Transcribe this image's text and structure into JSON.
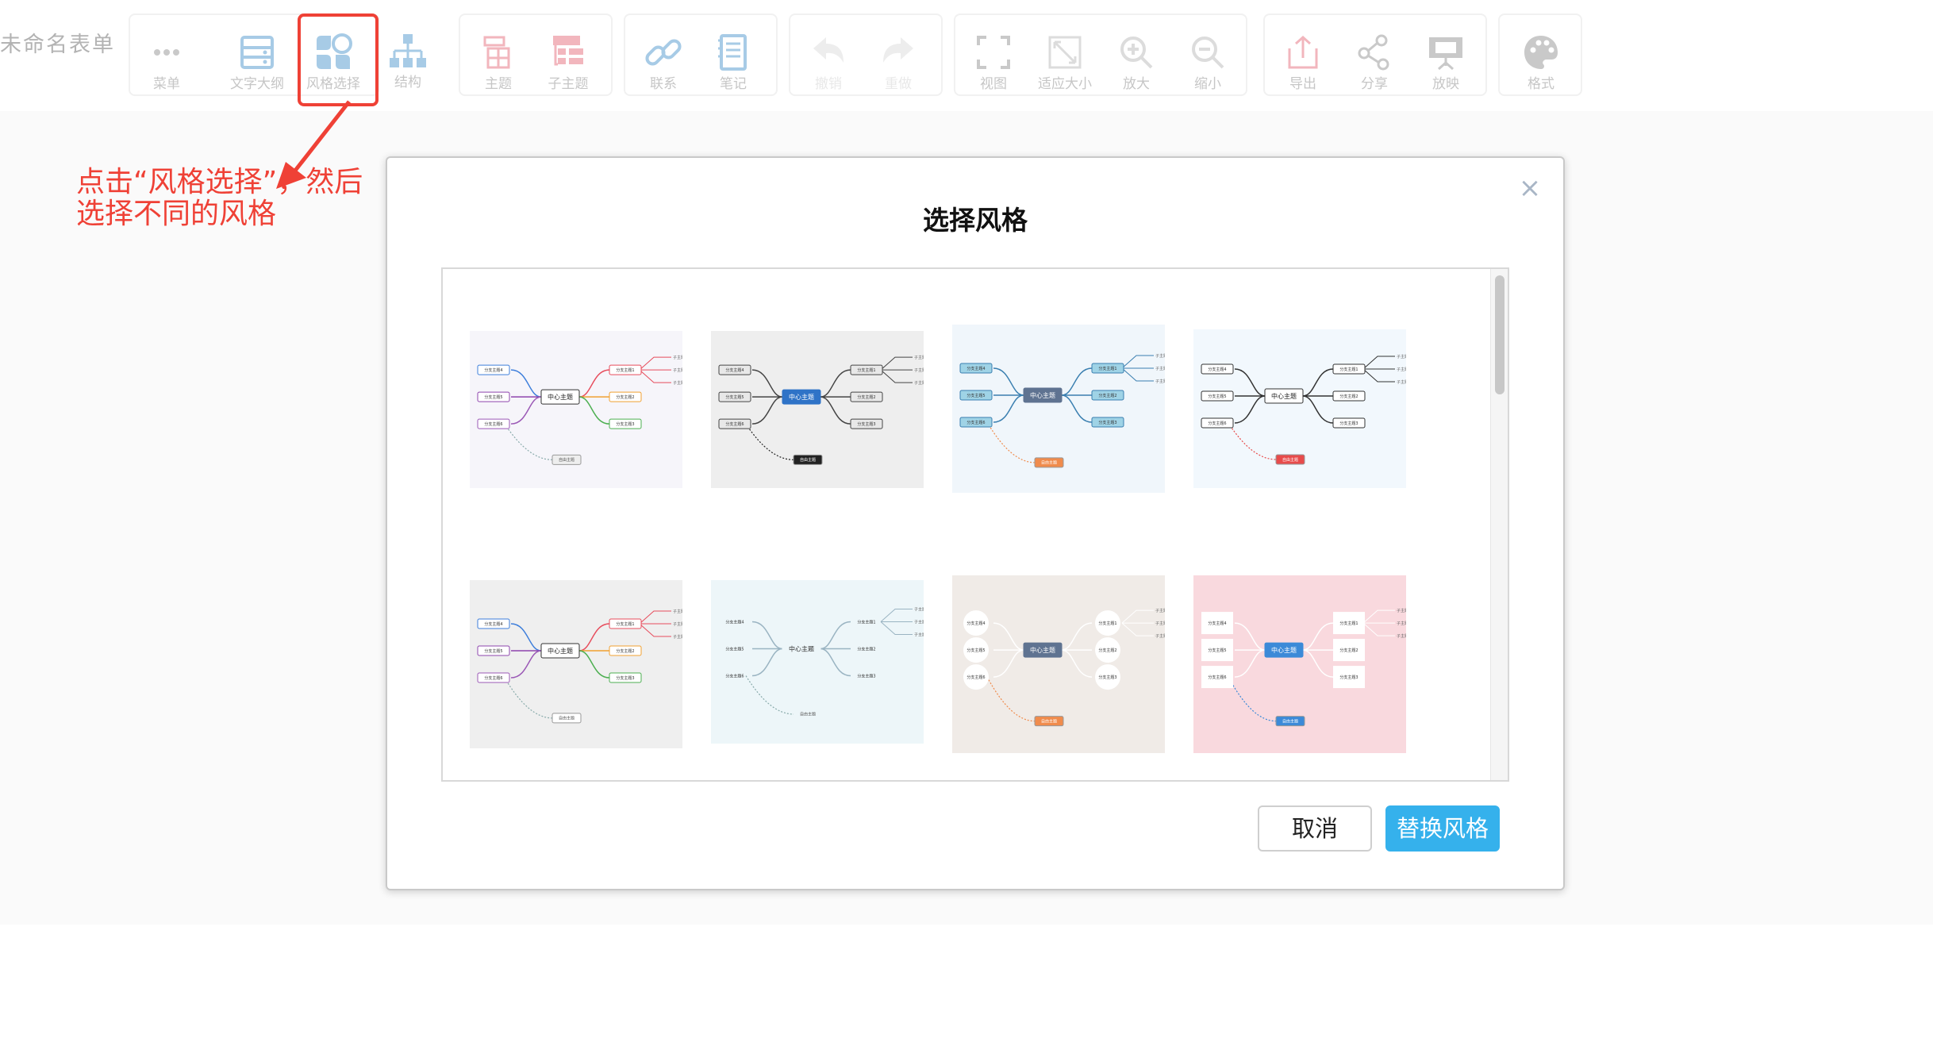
{
  "document": {
    "title": "未命名表单"
  },
  "toolbar": {
    "menu": "菜单",
    "outline": "文字大纲",
    "style_select": "风格选择",
    "structure": "结构",
    "topic": "主题",
    "subtopic": "子主题",
    "relation": "联系",
    "note": "笔记",
    "undo": "撤销",
    "redo": "重做",
    "view": "视图",
    "fit": "适应大小",
    "zoom_in": "放大",
    "zoom_out": "缩小",
    "export": "导出",
    "share": "分享",
    "present": "放映",
    "format": "格式"
  },
  "annotation": {
    "line1": "点击“风格选择”，然后",
    "line2": "选择不同的风格"
  },
  "dialog": {
    "title": "选择风格",
    "close": "×",
    "cancel": "取消",
    "confirm": "替换风格"
  },
  "mindmap_text": {
    "center": "中心主题",
    "branch_left": [
      "分支主题4",
      "分支主题5",
      "分支主题6"
    ],
    "branch_right": [
      "分支主题1",
      "分支主题2",
      "分支主题3"
    ],
    "subtopics": [
      "子主题1",
      "子主题2",
      "子主题3"
    ],
    "free": "自由主题"
  },
  "styles": [
    {
      "bg": "#f6f5fa",
      "center_fill": "#ffffff",
      "center_text": "#222222",
      "node_fill": "#ffffff",
      "accent": "#e74c5c",
      "branch_colors": [
        "#e74c5c",
        "#f0a030",
        "#4caf50"
      ],
      "left_colors": [
        "#3d7edb",
        "#8e44ad",
        "#9b59b6"
      ],
      "free_fill": "#eeeeee",
      "free_text": "#555555",
      "shape": "rect"
    },
    {
      "bg": "#eeeeee",
      "center_fill": "#2f73c7",
      "center_text": "#ffffff",
      "node_fill": "#e8e8e8",
      "accent": "#555555",
      "branch_colors": [
        "#444444",
        "#444444",
        "#444444"
      ],
      "left_colors": [
        "#444444",
        "#444444",
        "#444444"
      ],
      "free_fill": "#222222",
      "free_text": "#ffffff",
      "shape": "rect"
    },
    {
      "bg": "#f0f6fb",
      "center_fill": "#5f7391",
      "center_text": "#ffffff",
      "node_fill": "#9fd3e6",
      "accent": "#2b6f9a",
      "branch_colors": [
        "#3a7fb0",
        "#3a7fb0",
        "#3a7fb0"
      ],
      "left_colors": [
        "#3a7fb0",
        "#3a7fb0",
        "#3a7fb0"
      ],
      "free_fill": "#f08b4c",
      "free_text": "#ffffff",
      "shape": "rect"
    },
    {
      "bg": "#f2f8fd",
      "center_fill": "#ffffff",
      "center_text": "#222222",
      "node_fill": "#ffffff",
      "accent": "#333333",
      "branch_colors": [
        "#333333",
        "#333333",
        "#333333"
      ],
      "left_colors": [
        "#333333",
        "#333333",
        "#333333"
      ],
      "free_fill": "#e84b4b",
      "free_text": "#ffffff",
      "shape": "rect"
    },
    {
      "bg": "#efefef",
      "center_fill": "#ffffff",
      "center_text": "#222222",
      "node_fill": "#ffffff",
      "accent": "#e74c5c",
      "branch_colors": [
        "#e74c5c",
        "#f0a030",
        "#4caf50"
      ],
      "left_colors": [
        "#3d7edb",
        "#8e44ad",
        "#9b59b6"
      ],
      "free_fill": "#ffffff",
      "free_text": "#555555",
      "shape": "rect"
    },
    {
      "bg": "#edf6f9",
      "center_fill": "#edf6f9",
      "center_text": "#333333",
      "node_fill": "#edf6f9",
      "accent": "#9ab4c2",
      "branch_colors": [
        "#9ab4c2",
        "#9ab4c2",
        "#9ab4c2"
      ],
      "left_colors": [
        "#9ab4c2",
        "#9ab4c2",
        "#9ab4c2"
      ],
      "free_fill": "#edf6f9",
      "free_text": "#555555",
      "shape": "plain"
    },
    {
      "bg": "#f0ebe7",
      "center_fill": "#5f7391",
      "center_text": "#ffffff",
      "node_fill": "#ffffff",
      "accent": "#ffffff",
      "branch_colors": [
        "#ffffff",
        "#ffffff",
        "#ffffff"
      ],
      "left_colors": [
        "#ffffff",
        "#ffffff",
        "#ffffff"
      ],
      "free_fill": "#f08b4c",
      "free_text": "#ffffff",
      "shape": "circle"
    },
    {
      "bg": "#f9d9de",
      "center_fill": "#3c8ad8",
      "center_text": "#ffffff",
      "node_fill": "#ffffff",
      "accent": "#ffffff",
      "branch_colors": [
        "#ffffff",
        "#ffffff",
        "#ffffff"
      ],
      "left_colors": [
        "#ffffff",
        "#ffffff",
        "#ffffff"
      ],
      "free_fill": "#3c8ad8",
      "free_text": "#ffffff",
      "shape": "square"
    }
  ]
}
